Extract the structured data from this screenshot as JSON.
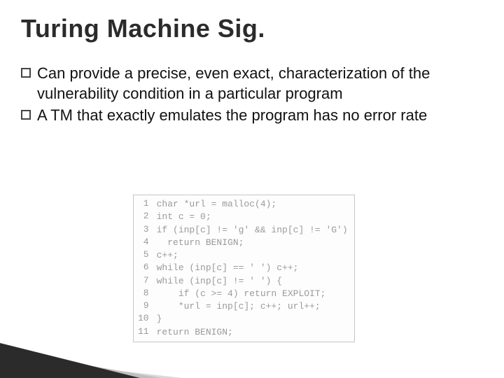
{
  "title": "Turing Machine Sig.",
  "bullets": [
    "Can provide a precise, even exact, characterization of the vulnerability condition in a particular program",
    "A TM that exactly emulates the program has no error rate"
  ],
  "code": {
    "lines": [
      "char *url = malloc(4);",
      "int c = 0;",
      "if (inp[c] != 'g' && inp[c] != 'G')",
      "  return BENIGN;",
      "c++;",
      "while (inp[c] == ' ') c++;",
      "while (inp[c] != ' ') {",
      "    if (c >= 4) return EXPLOIT;",
      "    *url = inp[c]; c++; url++;",
      "}",
      "return BENIGN;"
    ]
  }
}
